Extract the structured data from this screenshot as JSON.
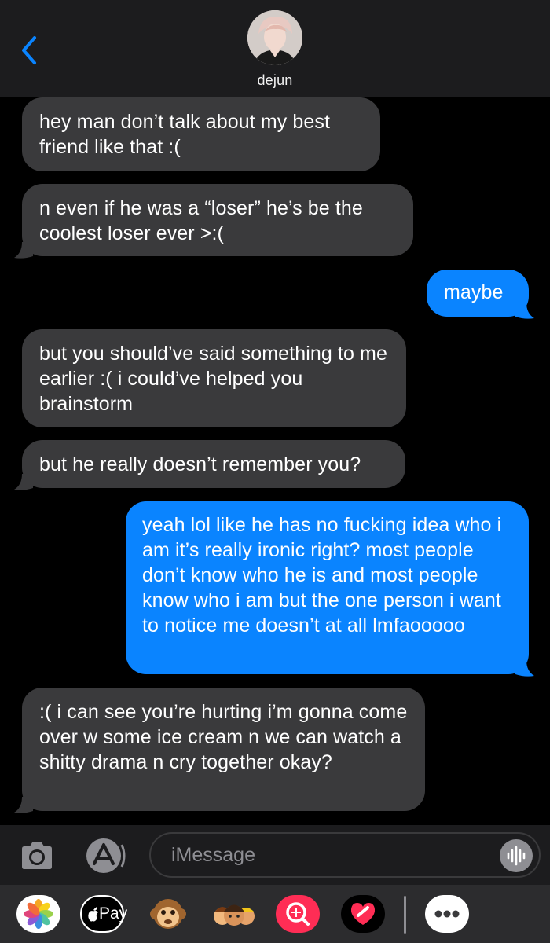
{
  "header": {
    "contact_name": "dejun",
    "back_icon": "chevron-left-icon",
    "accent_color": "#0a84ff"
  },
  "messages": [
    {
      "direction": "incoming",
      "text": "hey man don’t talk about my best friend like that :("
    },
    {
      "direction": "incoming",
      "text": "n even if he was a “loser” he’s be the coolest loser ever >:("
    },
    {
      "direction": "outgoing",
      "text": "maybe"
    },
    {
      "direction": "incoming",
      "text": "but you should’ve said something to me earlier :( i could’ve helped you brainstorm"
    },
    {
      "direction": "incoming",
      "text": "but he really doesn’t remember you?"
    },
    {
      "direction": "outgoing",
      "text": "yeah lol like he has no fucking idea who i am it’s really ironic right? most people don’t know who he is and most people know who i am but the one person i want to notice me doesn’t at all lmfaooooo"
    },
    {
      "direction": "incoming",
      "text": ":( i can see you’re hurting i’m gonna come over w some ice cream n we can watch a shitty drama n cry together okay?"
    }
  ],
  "input_bar": {
    "placeholder": "iMessage",
    "camera_icon": "camera-icon",
    "apps_icon": "app-store-icon",
    "audio_icon": "audio-waveform-icon"
  },
  "app_drawer": {
    "apps": [
      {
        "icon": "photos-icon"
      },
      {
        "icon": "apple-pay-icon",
        "label": "Pay"
      },
      {
        "icon": "animoji-monkey-icon"
      },
      {
        "icon": "memoji-icon"
      },
      {
        "icon": "gif-search-icon"
      },
      {
        "icon": "digital-touch-heart-icon"
      },
      {
        "icon": "more-apps-icon"
      }
    ]
  },
  "colors": {
    "incoming_bubble": "#3a3a3c",
    "outgoing_bubble": "#0a84ff",
    "background": "#000000"
  }
}
